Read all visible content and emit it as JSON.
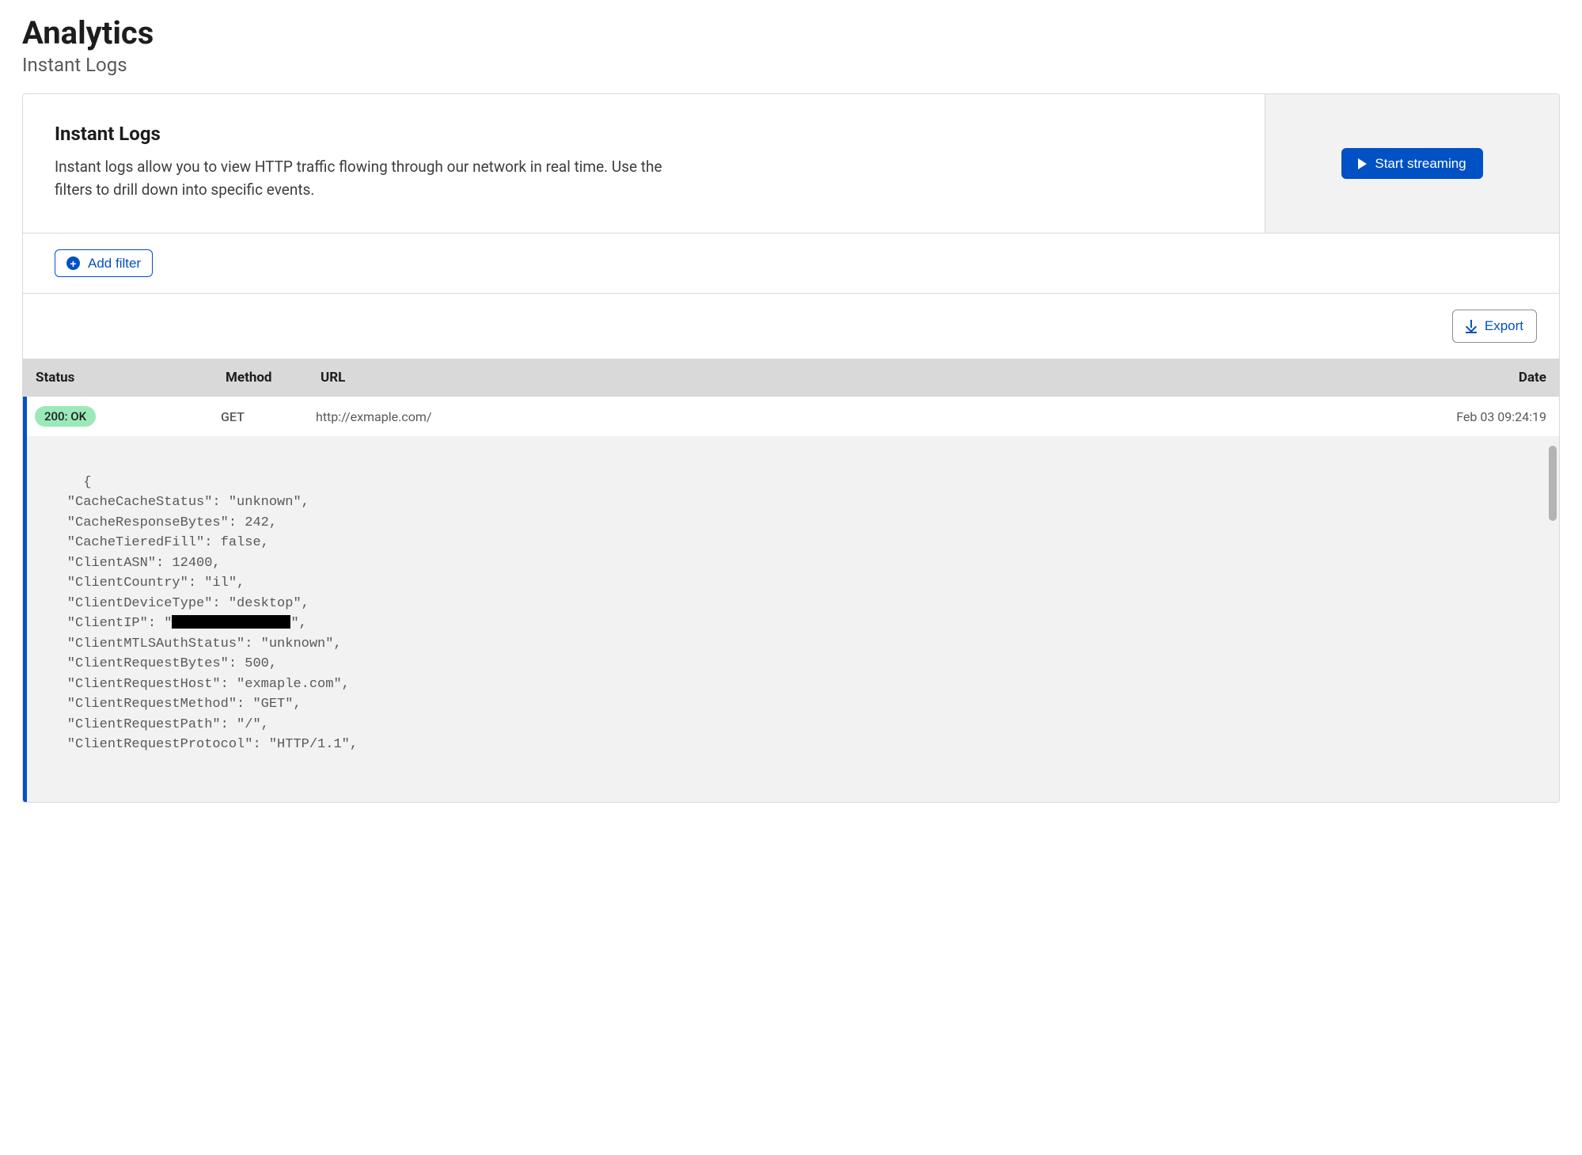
{
  "page": {
    "title": "Analytics",
    "subtitle": "Instant Logs"
  },
  "panel": {
    "heading": "Instant Logs",
    "description": "Instant logs allow you to view HTTP traffic flowing through our network in real time. Use the filters to drill down into specific events.",
    "start_button_label": "Start streaming",
    "add_filter_label": "Add filter",
    "export_label": "Export"
  },
  "table": {
    "columns": {
      "status": "Status",
      "method": "Method",
      "url": "URL",
      "date": "Date"
    }
  },
  "log_entry": {
    "status_label": "200: OK",
    "method": "GET",
    "url": "http://exmaple.com/",
    "date": "Feb 03 09:24:19"
  },
  "log_detail": {
    "CacheCacheStatus": "unknown",
    "CacheResponseBytes": 242,
    "CacheTieredFill": false,
    "ClientASN": 12400,
    "ClientCountry": "il",
    "ClientDeviceType": "desktop",
    "ClientIP_redacted": true,
    "ClientMTLSAuthStatus": "unknown",
    "ClientRequestBytes": 500,
    "ClientRequestHost": "exmaple.com",
    "ClientRequestMethod": "GET",
    "ClientRequestPath": "/",
    "ClientRequestProtocol": "HTTP/1.1"
  }
}
